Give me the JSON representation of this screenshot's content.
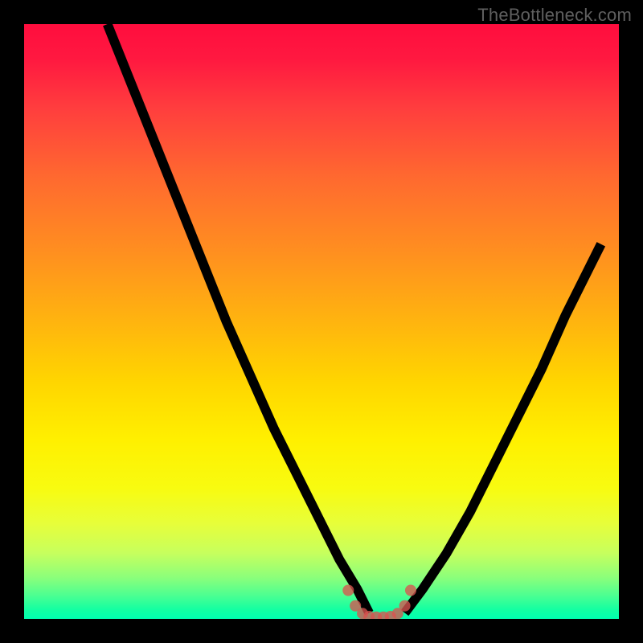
{
  "watermark": "TheBottleneck.com",
  "colors": {
    "frame_bg": "#000000",
    "watermark_text": "#5f5f5f",
    "gradient_top": "#ff0d3e",
    "gradient_mid1": "#ffb40f",
    "gradient_mid2": "#fff000",
    "gradient_bottom": "#00ffb0",
    "curve": "#000000",
    "valley_marker": "#d9534f"
  },
  "chart_data": {
    "type": "line",
    "title": "",
    "xlabel": "",
    "ylabel": "",
    "x_range": [
      0,
      100
    ],
    "y_range": [
      0,
      100
    ],
    "note": "V-shaped bottleneck curve over a vertical red-to-green heatmap gradient. y ≈ 0 marks no bottleneck (green); higher y = more bottleneck (red). x is the balance axis. Values estimated from pixels.",
    "series": [
      {
        "name": "left-branch",
        "x": [
          14,
          18,
          22,
          26,
          30,
          34,
          38,
          42,
          46,
          50,
          53,
          56,
          58
        ],
        "y": [
          100,
          90,
          80,
          70,
          60,
          50,
          41,
          32,
          24,
          16,
          10,
          5,
          1
        ]
      },
      {
        "name": "right-branch",
        "x": [
          64,
          67,
          71,
          75,
          79,
          83,
          87,
          91,
          95,
          97
        ],
        "y": [
          1,
          5,
          11,
          18,
          26,
          34,
          42,
          51,
          59,
          63
        ]
      },
      {
        "name": "valley-markers",
        "x": [
          54.5,
          55.7,
          56.9,
          58.0,
          59.2,
          60.4,
          61.6,
          62.8,
          64.0,
          65.0
        ],
        "y": [
          4.8,
          2.2,
          0.9,
          0.4,
          0.3,
          0.3,
          0.4,
          0.9,
          2.2,
          4.8
        ]
      }
    ],
    "background_gradient_stops": [
      {
        "pos": 0.0,
        "color": "#ff0d3e"
      },
      {
        "pos": 0.26,
        "color": "#ff6a2f"
      },
      {
        "pos": 0.5,
        "color": "#ffb40f"
      },
      {
        "pos": 0.7,
        "color": "#fff000"
      },
      {
        "pos": 0.89,
        "color": "#c6ff5e"
      },
      {
        "pos": 1.0,
        "color": "#00ffb0"
      }
    ]
  }
}
